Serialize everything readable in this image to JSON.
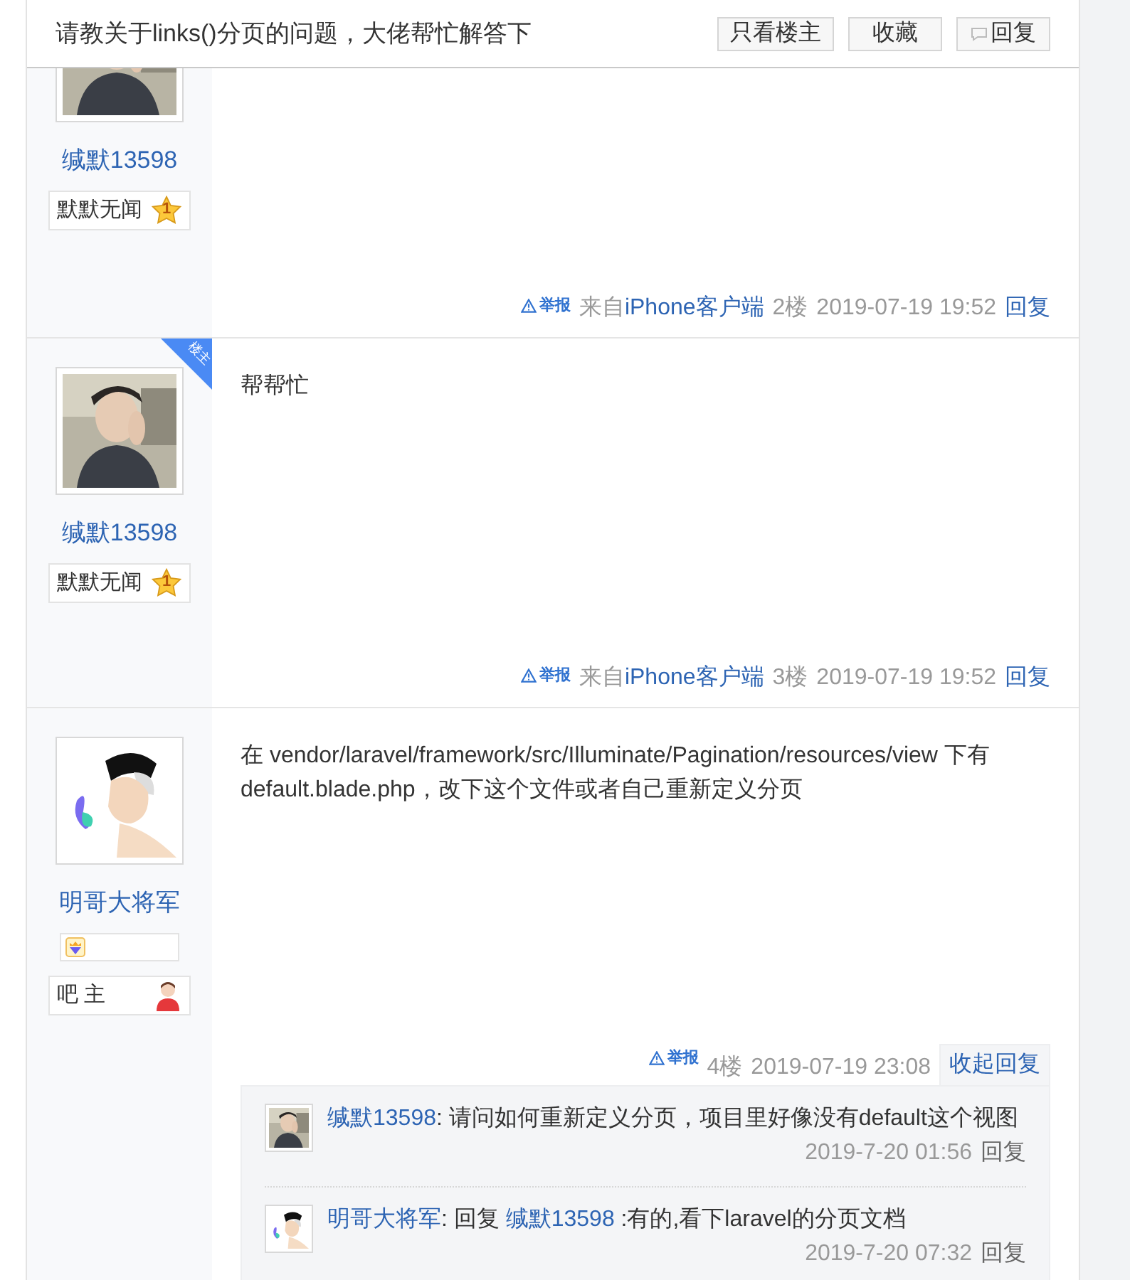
{
  "header": {
    "title": "请教关于links()分页的问题，大佬帮忙解答下",
    "buttons": [
      {
        "kind": "plain",
        "label": "只看楼主"
      },
      {
        "kind": "plain",
        "label": "收藏"
      },
      {
        "kind": "reply",
        "label": "回复"
      }
    ]
  },
  "posts": [
    {
      "author": "缄默13598",
      "rank": {
        "kind": "star",
        "label": "默默无闻",
        "level_text": "1"
      },
      "extra_badge": false,
      "footer": {
        "report": "举报",
        "source_prefix": "来自",
        "source": "iPhone客户端",
        "floor": "2楼",
        "time": "2019-07-19 19:52",
        "reply": "回复",
        "reply_open": false
      }
    },
    {
      "author": "缄默13598",
      "owner_badge": "楼主",
      "rank": {
        "kind": "star",
        "label": "默默无闻",
        "level_text": "1"
      },
      "extra_badge": false,
      "content": "帮帮忙",
      "footer": {
        "report": "举报",
        "source_prefix": "来自",
        "source": "iPhone客户端",
        "floor": "3楼",
        "time": "2019-07-19 19:52",
        "reply": "回复",
        "reply_open": false
      }
    },
    {
      "author": "明哥大将军",
      "rank": {
        "kind": "admin",
        "label": "吧 主"
      },
      "extra_badge": true,
      "content": "在 vendor/laravel/framework/src/Illuminate/Pagination/resources/view 下有default.blade.php，改下这个文件或者自己重新定义分页",
      "footer": {
        "report": "举报",
        "floor": "4楼",
        "time": "2019-07-19 23:08",
        "reply": "收起回复",
        "reply_open": true
      },
      "comments": [
        {
          "author": "缄默13598",
          "text": ": 请问如何重新定义分页，项目里好像没有default这个视图",
          "time": "2019-7-20 01:56",
          "reply": "回复"
        },
        {
          "author": "明哥大将军",
          "reply_prefix": ": 回复 ",
          "reply_to": "缄默13598",
          "text": " :有的,看下laravel的分页文档",
          "time": "2019-7-20 07:32",
          "reply": "回复"
        }
      ]
    }
  ]
}
